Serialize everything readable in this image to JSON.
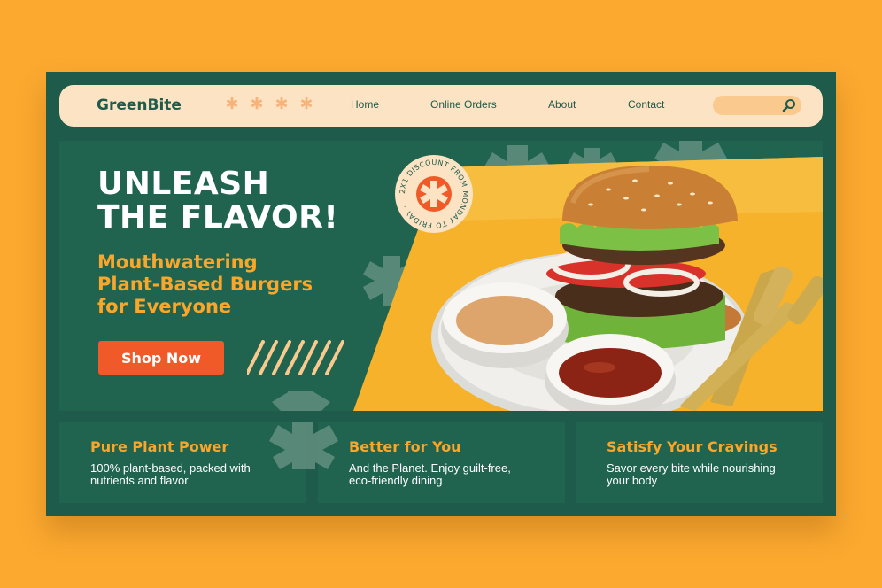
{
  "colors": {
    "background": "#FBA92F",
    "frame": "#1E5B4A",
    "panel": "#206450",
    "accent_orange": "#F9A62A",
    "button_red": "#F05A28",
    "nav_bg": "#FCE3C4"
  },
  "nav": {
    "brand": "GreenBite",
    "links": [
      "Home",
      "Online Orders",
      "About",
      "Contact"
    ],
    "search": {
      "placeholder": "",
      "icon": "search-icon"
    },
    "decor_icons": [
      "asterisk-icon",
      "asterisk-icon",
      "asterisk-icon",
      "asterisk-icon"
    ]
  },
  "hero": {
    "title_line1": "UNLEASH",
    "title_line2": "THE FLAVOR!",
    "subtitle_line1": "Mouthwatering",
    "subtitle_line2": "Plant-Based Burgers",
    "subtitle_line3": "for Everyone",
    "cta": "Shop Now",
    "badge_text": "2X1 DISCOUNT FROM MONDAY TO FRIDAY · "
  },
  "features": [
    {
      "title": "Pure Plant Power",
      "text": "100% plant-based, packed with nutrients and flavor"
    },
    {
      "title": "Better for You",
      "text": "And the Planet. Enjoy guilt-free, eco-friendly dining"
    },
    {
      "title": "Satisfy Your Cravings",
      "text": "Savor every bite while nourishing your body"
    }
  ]
}
